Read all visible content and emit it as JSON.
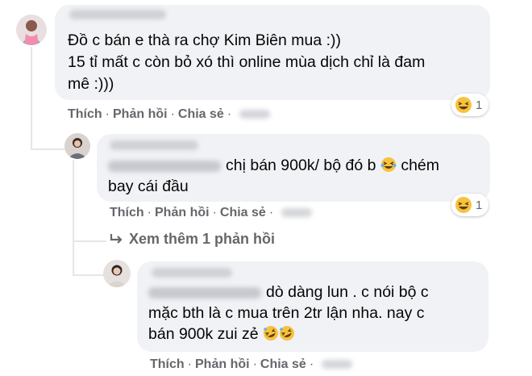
{
  "comments": [
    {
      "lines": [
        "Đồ c bán e thà ra chợ Kim Biên mua :))",
        "15 tỉ mất c còn bỏ xó thì online mùa dịch chỉ là đam",
        "mê :)))"
      ],
      "actions": {
        "like": "Thích",
        "reply": "Phản hồi",
        "share": "Chia sẻ"
      },
      "reaction": {
        "icon": "laughing-emoji-icon",
        "count": "1"
      }
    },
    {
      "line1": "chị bán 900k/ bộ đó b",
      "line1_tail": "chém",
      "line2": "bay cái đầu",
      "actions": {
        "like": "Thích",
        "reply": "Phản hồi",
        "share": "Chia sẻ"
      },
      "reaction": {
        "icon": "laughing-emoji-icon",
        "count": "1"
      }
    },
    {
      "line1": "dò dàng lun . c nói bộ c",
      "line2": "mặc bth là c mua trên 2tr lận nha. nay c",
      "line3": "bán 900k zui zẻ",
      "actions": {
        "like": "Thích",
        "reply": "Phản hồi",
        "share": "Chia sẻ"
      }
    }
  ],
  "more_replies": {
    "icon": "reply-arrow-icon",
    "label": "Xem thêm 1 phản hồi"
  },
  "colors": {
    "bubble": "#f0f2f5",
    "meta": "#65676b",
    "text": "#050505",
    "line": "#e4e6eb"
  }
}
